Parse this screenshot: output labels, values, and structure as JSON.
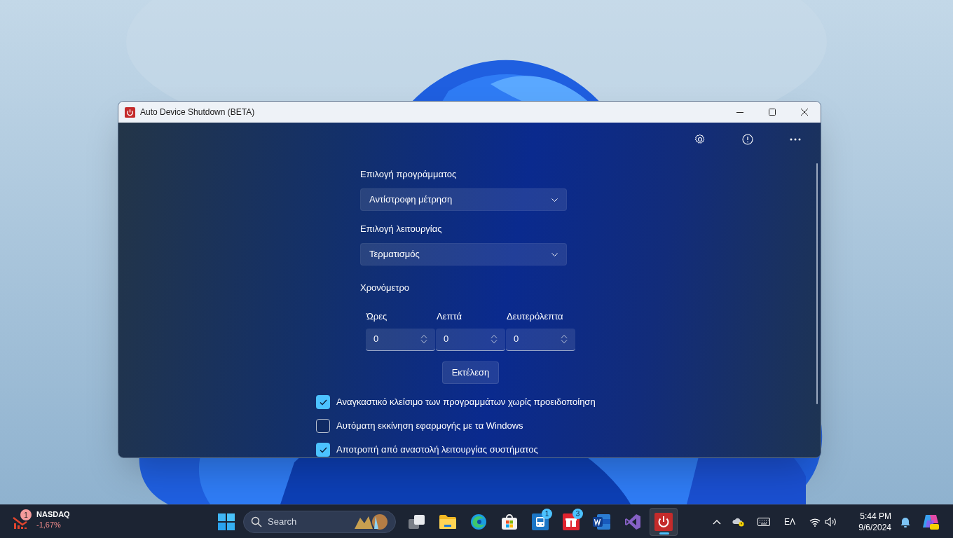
{
  "window": {
    "title": "Auto Device Shutdown (BETA)"
  },
  "form": {
    "fields": [
      {
        "label": "Επιλογή προγράμματος",
        "value": "Αντίστροφη μέτρηση"
      },
      {
        "label": "Επιλογή λειτουργίας",
        "value": "Τερματισμός"
      }
    ],
    "timer": {
      "label": "Χρονόμετρο",
      "units": [
        {
          "label": "Ώρες",
          "value": "0"
        },
        {
          "label": "Λεπτά",
          "value": "0"
        },
        {
          "label": "Δευτερόλεπτα",
          "value": "0"
        }
      ]
    },
    "run_button": "Εκτέλεση",
    "options": [
      {
        "label": "Αναγκαστικό κλείσιμο των προγραμμάτων χωρίς προειδοποίηση",
        "checked": true
      },
      {
        "label": "Αυτόματη εκκίνηση εφαρμογής με τα Windows",
        "checked": false
      },
      {
        "label": "Αποτροπή από αναστολή λειτουργίας συστήματος",
        "checked": true
      }
    ]
  },
  "taskbar": {
    "widget": {
      "badge": "1",
      "name": "NASDAQ",
      "change": "-1,67%"
    },
    "search": {
      "placeholder": "Search"
    },
    "apps": [
      {
        "kind": "taskview",
        "selected": false
      },
      {
        "kind": "folder",
        "selected": false
      },
      {
        "kind": "browser",
        "selected": false
      },
      {
        "kind": "store",
        "selected": false
      },
      {
        "kind": "bus",
        "badge": "1",
        "selected": false
      },
      {
        "kind": "gift",
        "badge": "3",
        "selected": false
      },
      {
        "kind": "word",
        "selected": false
      },
      {
        "kind": "studio",
        "selected": false
      },
      {
        "kind": "power",
        "selected": true
      }
    ],
    "language": "ΕΛ",
    "time": "5:44 PM",
    "date": "9/6/2024"
  }
}
